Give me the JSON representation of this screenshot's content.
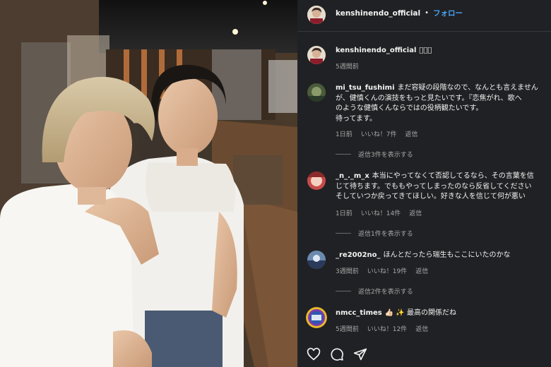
{
  "post": {
    "username": "kenshinendo_official",
    "dot": "•",
    "follow_label": "フォロー",
    "caption_user": "kenshinendo_official",
    "caption_text": "􀀀􀀀􀀀",
    "caption_time": "5週間前"
  },
  "comments": [
    {
      "user": "mi_tsu_fushimi",
      "lines": [
        "まだ容疑の段階なので、なんとも言えません",
        "が、健慎くんの演技をもっと見たいです。『恋焦がれ、歌へ",
        "のような健慎くんならではの役柄観たいです。",
        "待ってます。"
      ],
      "time": "1日前",
      "likes": "いいね！7件",
      "reply": "返信",
      "more_replies": "返信3件を表示する"
    },
    {
      "user": "_n_._m_x",
      "lines": [
        "本当にやってなくて否認してるなら、その言葉を信",
        "じて待ちます。でももやってしまったのなら反省してください",
        "そしていつか戻ってきてほしい。好きな人を信じて何が悪い"
      ],
      "time": "1日前",
      "likes": "いいね！14件",
      "reply": "返信",
      "more_replies": "返信1件を表示する"
    },
    {
      "user": "_re2002no_",
      "lines": [
        "ほんとだったら瑞生もここにいたのかな"
      ],
      "time": "3週間前",
      "likes": "いいね！19件",
      "reply": "返信",
      "more_replies": "返信2件を表示する"
    },
    {
      "user": "nmcc_times",
      "lines": [
        "👍🏻 ✨ 最高の関係だね"
      ],
      "time": "5週間前",
      "likes": "いいね！12件",
      "reply": "返信"
    }
  ],
  "colors": {
    "panel_bg": "#202124",
    "link": "#4aa3f5",
    "muted": "#a8a8a8"
  },
  "icons": [
    "heart-icon",
    "comment-icon",
    "share-icon"
  ]
}
